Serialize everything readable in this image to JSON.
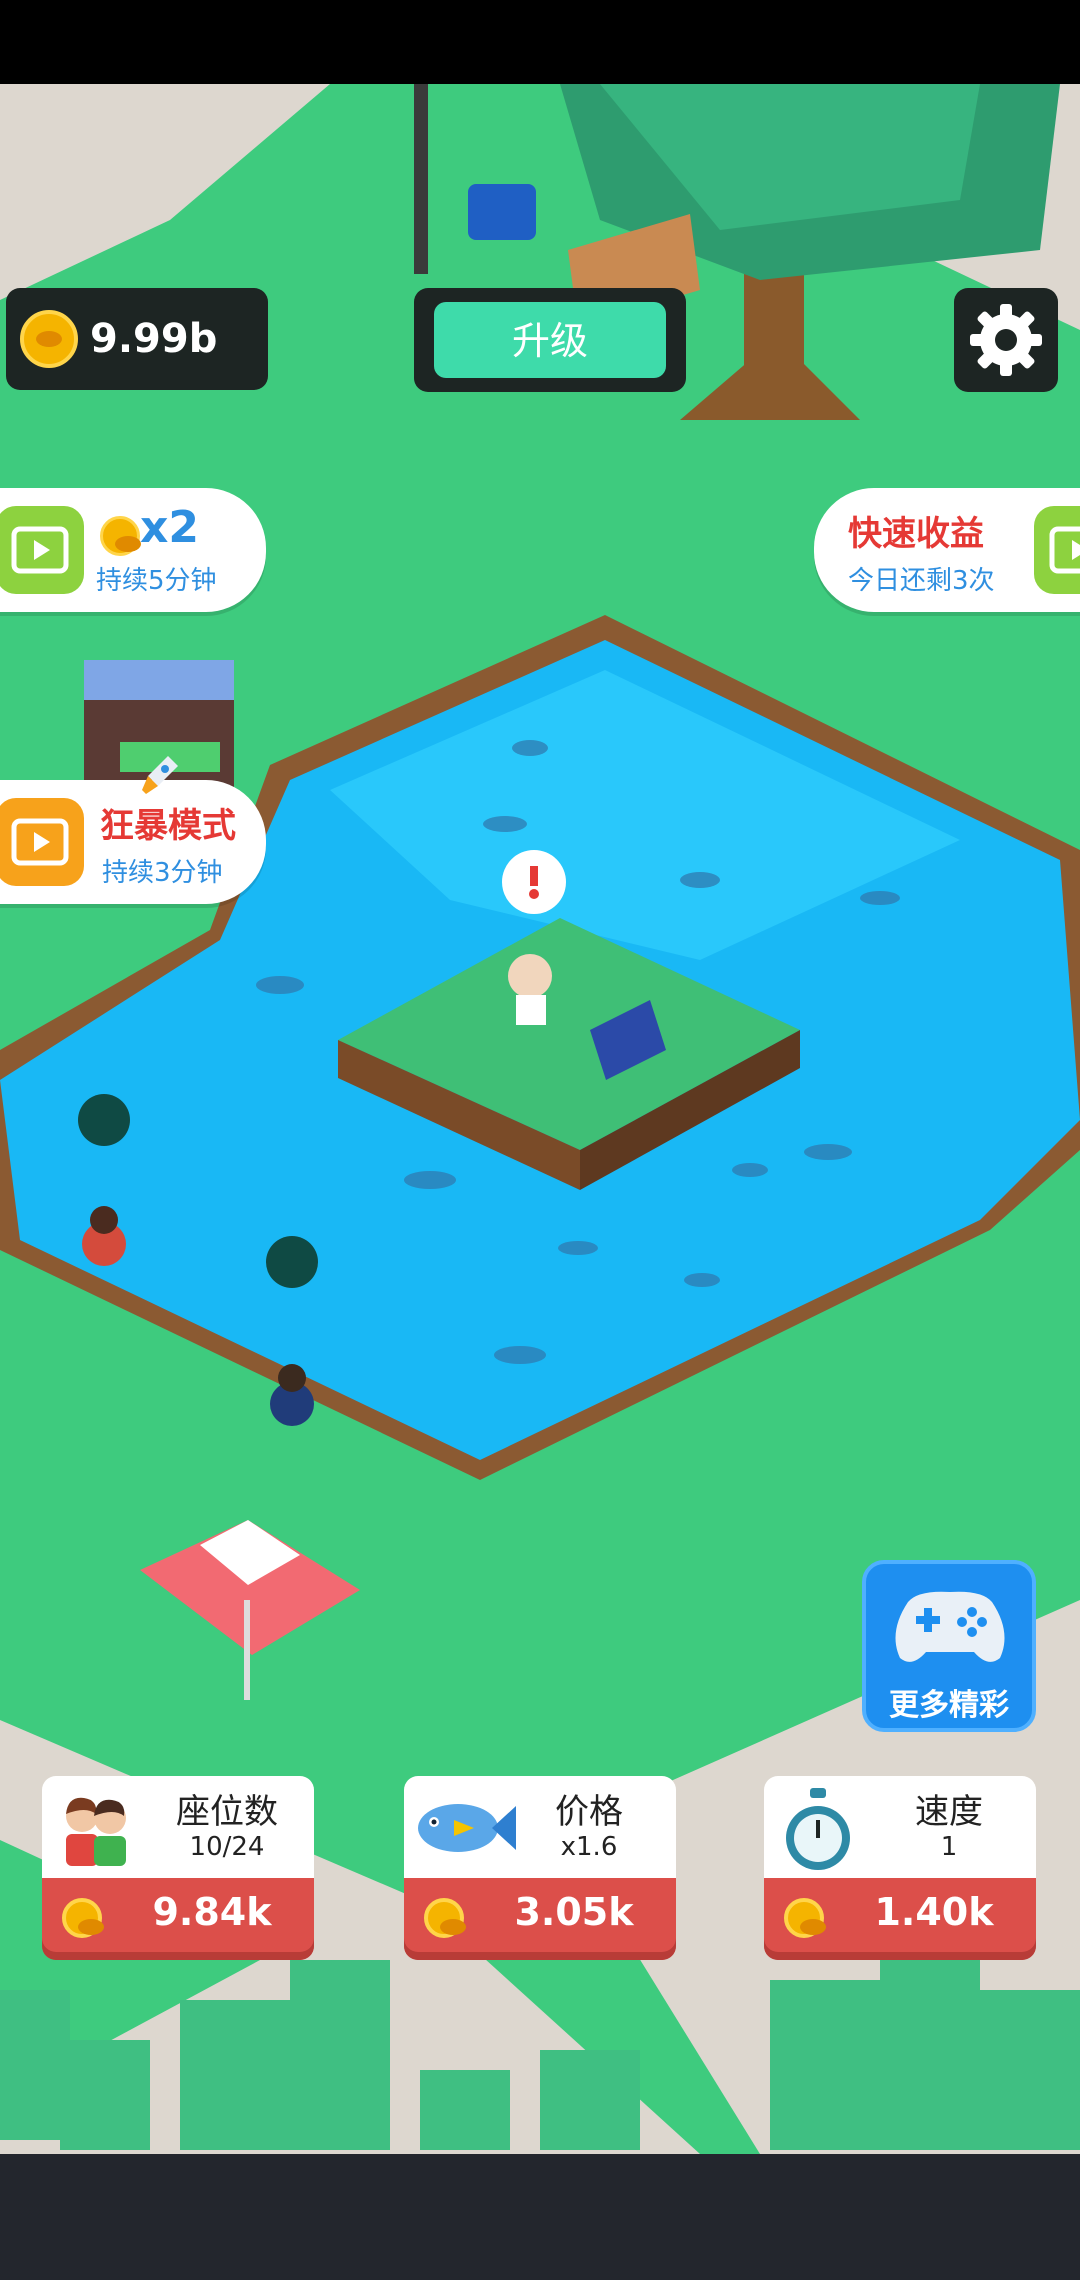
{
  "hud": {
    "coins": "9.99b",
    "upgrade_label": "升级"
  },
  "boosts": {
    "double": {
      "multiplier": "x2",
      "duration": "持续5分钟"
    },
    "quick_income": {
      "title": "快速收益",
      "remaining": "今日还剩3次"
    },
    "frenzy": {
      "title": "狂暴模式",
      "duration": "持续3分钟"
    }
  },
  "more_games": {
    "label": "更多精彩"
  },
  "stats": [
    {
      "title": "座位数",
      "value": "10/24",
      "cost": "9.84k"
    },
    {
      "title": "价格",
      "value": "x1.6",
      "cost": "3.05k"
    },
    {
      "title": "速度",
      "value": "1",
      "cost": "1.40k"
    }
  ],
  "colors": {
    "grass": "#3ecb7e",
    "water": "#19b8f5",
    "button_green": "#3edbaa",
    "cost_red": "#dc4f4a",
    "hud_dark": "#1d2523"
  },
  "icons": [
    "coin-icon",
    "gear-icon",
    "video-icon",
    "rocket-icon",
    "gamepad-icon",
    "people-icon",
    "fish-icon",
    "stopwatch-icon"
  ]
}
